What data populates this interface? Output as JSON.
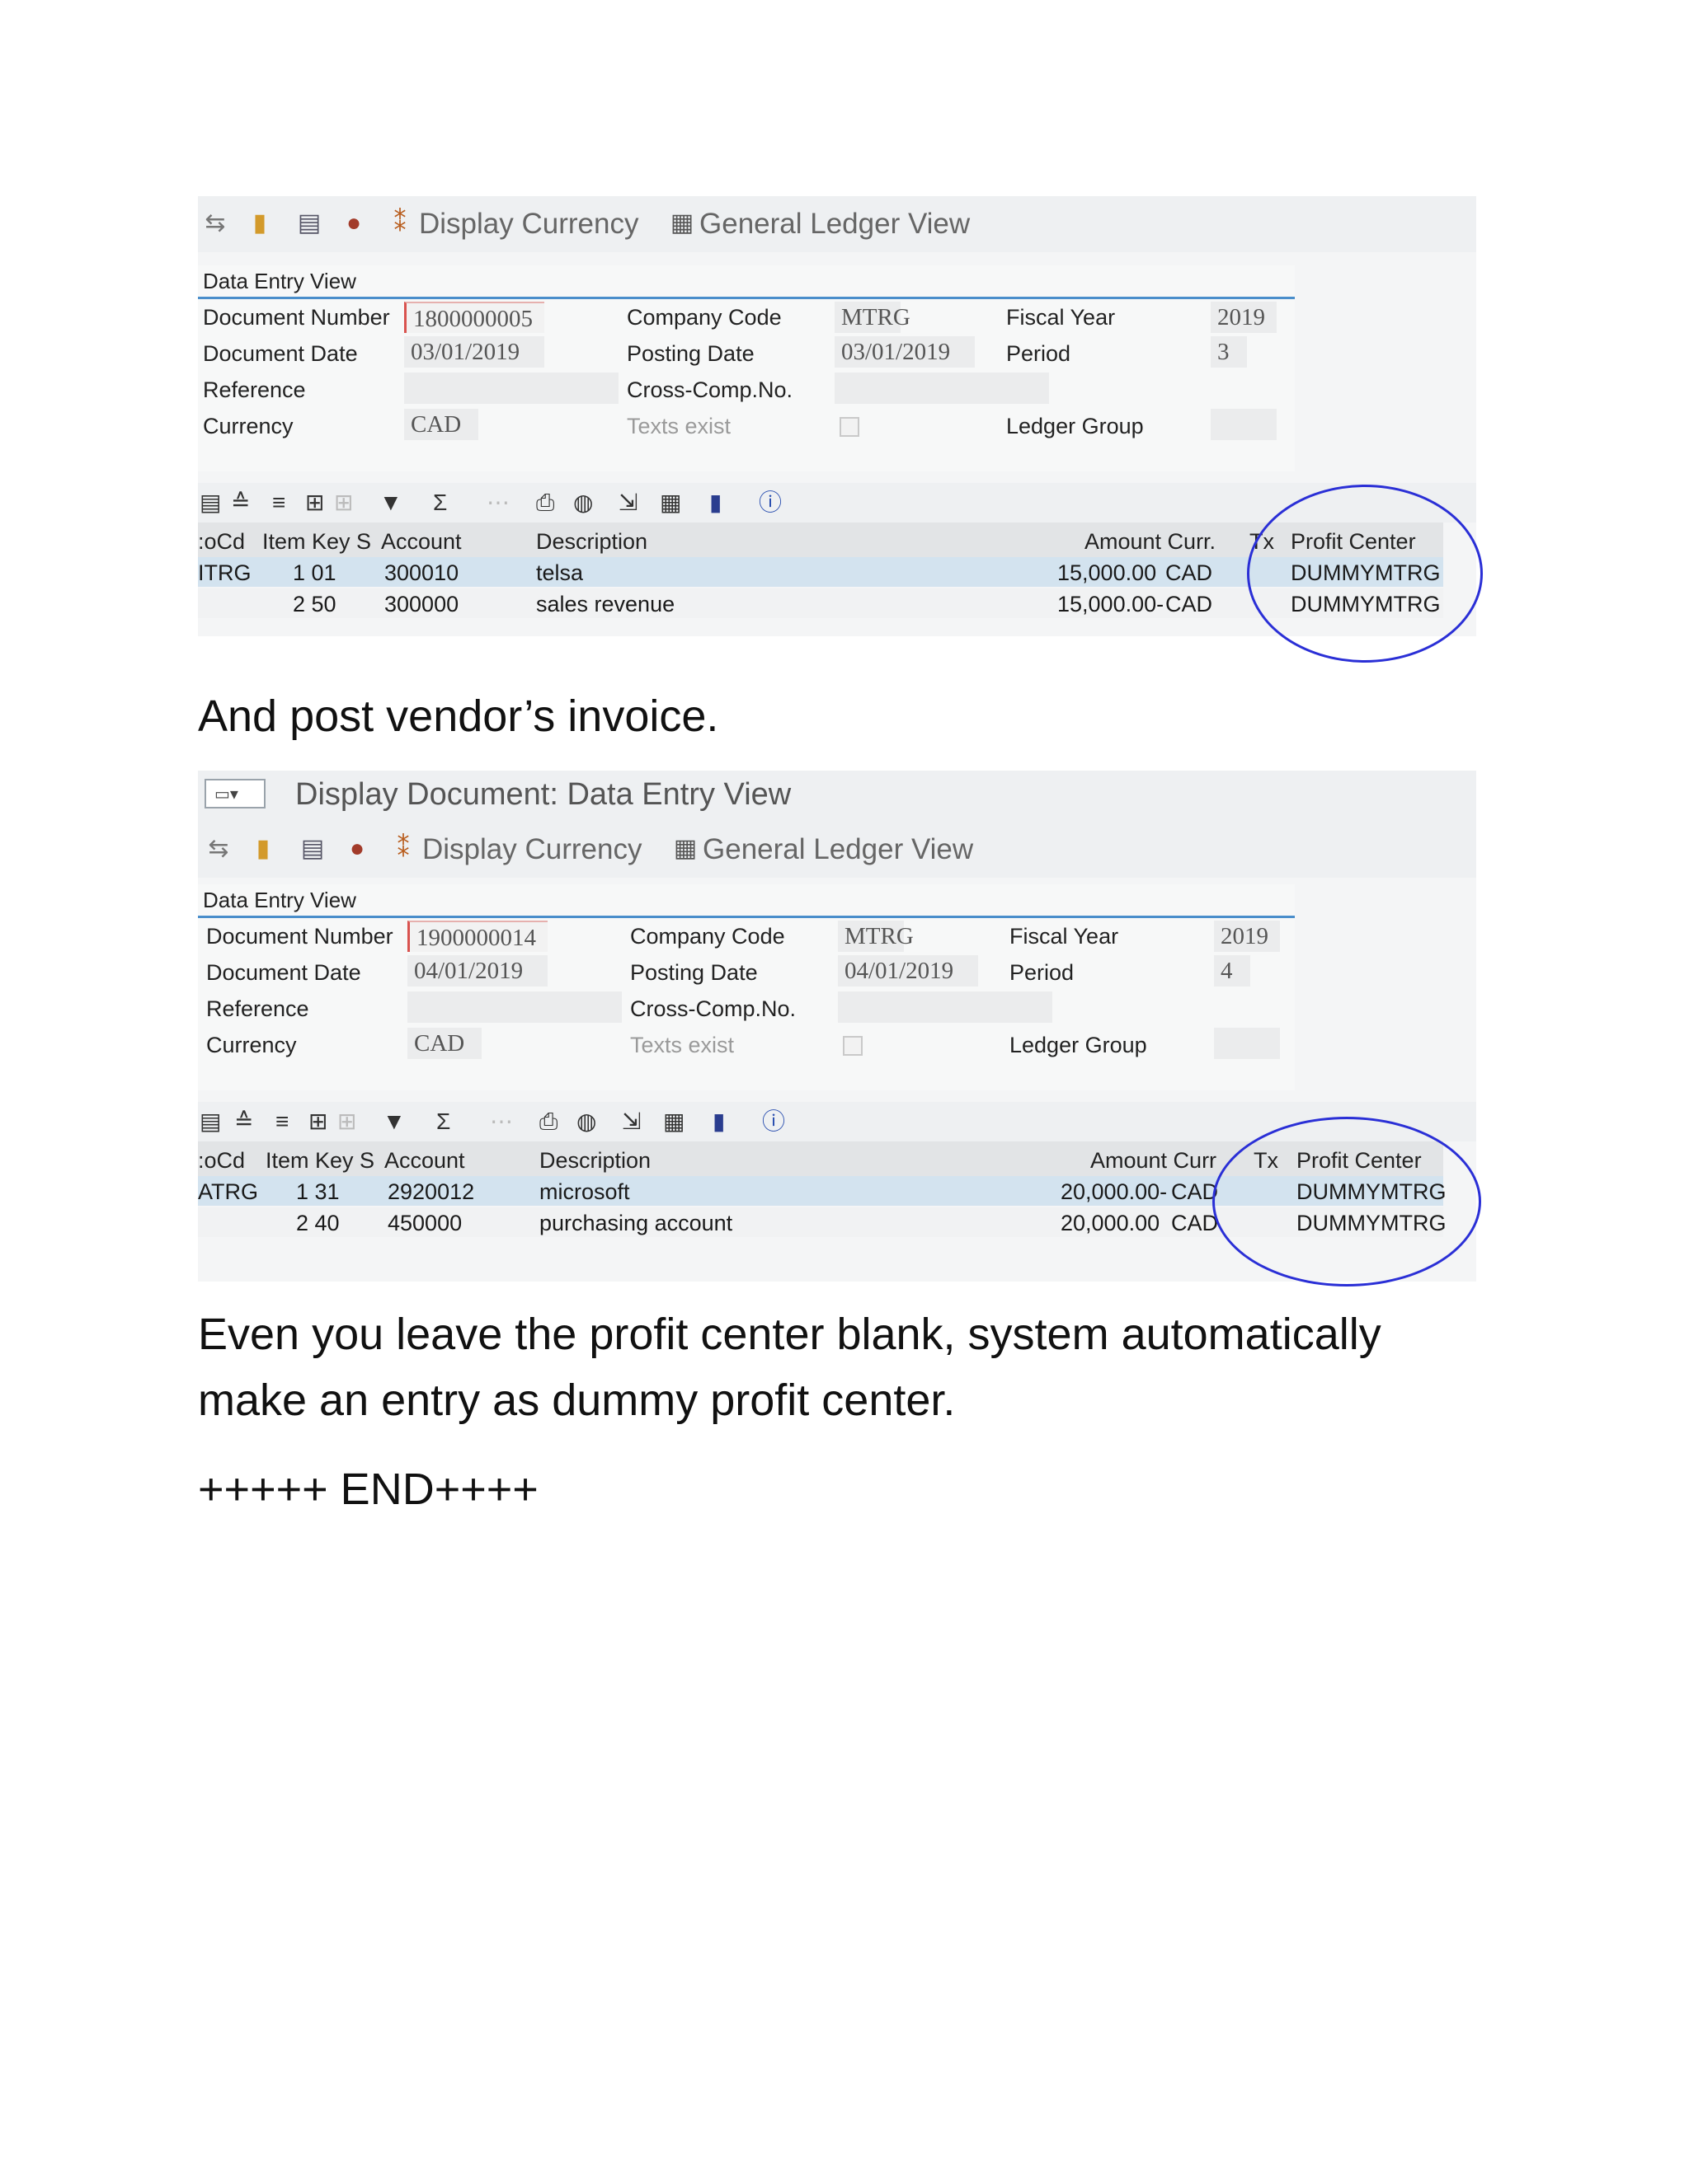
{
  "doc1": {
    "toolbar": {
      "display_currency": "Display Currency",
      "gl_view": "General Ledger View"
    },
    "panel_title": "Data Entry View",
    "fields": {
      "document_number_label": "Document Number",
      "document_number": "1800000005",
      "document_date_label": "Document Date",
      "document_date": "03/01/2019",
      "reference_label": "Reference",
      "reference": "",
      "currency_label": "Currency",
      "currency": "CAD",
      "company_code_label": "Company Code",
      "company_code": "MTRG",
      "posting_date_label": "Posting Date",
      "posting_date": "03/01/2019",
      "cross_comp_label": "Cross-Comp.No.",
      "cross_comp": "",
      "texts_exist_label": "Texts exist",
      "fiscal_year_label": "Fiscal Year",
      "fiscal_year": "2019",
      "period_label": "Period",
      "period": "3",
      "ledger_group_label": "Ledger Group",
      "ledger_group": ""
    },
    "table": {
      "headers": {
        "cocd": ":oCd",
        "item": "Item Key S",
        "account": "Account",
        "description": "Description",
        "amount": "Amount Curr.",
        "tx": "Tx",
        "profit_center": "Profit Center"
      },
      "rows": [
        {
          "cocd": "ITRG",
          "item": "1 01",
          "account": "300010",
          "description": "telsa",
          "amount": "15,000.00",
          "curr": "CAD",
          "profit_center": "DUMMYMTRG"
        },
        {
          "cocd": "",
          "item": "2 50",
          "account": "300000",
          "description": "sales revenue",
          "amount": "15,000.00-",
          "curr": "CAD",
          "profit_center": "DUMMYMTRG"
        }
      ]
    }
  },
  "intro_text": "And post vendor’s invoice.",
  "doc2": {
    "window_title": "Display Document: Data Entry View",
    "toolbar": {
      "display_currency": "Display Currency",
      "gl_view": "General Ledger View"
    },
    "panel_title": "Data Entry View",
    "fields": {
      "document_number_label": "Document Number",
      "document_number": "1900000014",
      "document_date_label": "Document Date",
      "document_date": "04/01/2019",
      "reference_label": "Reference",
      "reference": "",
      "currency_label": "Currency",
      "currency": "CAD",
      "company_code_label": "Company Code",
      "company_code": "MTRG",
      "posting_date_label": "Posting Date",
      "posting_date": "04/01/2019",
      "cross_comp_label": "Cross-Comp.No.",
      "cross_comp": "",
      "texts_exist_label": "Texts exist",
      "fiscal_year_label": "Fiscal Year",
      "fiscal_year": "2019",
      "period_label": "Period",
      "period": "4",
      "ledger_group_label": "Ledger Group",
      "ledger_group": ""
    },
    "table": {
      "headers": {
        "cocd": ":oCd",
        "item": "Item Key S",
        "account": "Account",
        "description": "Description",
        "amount": "Amount Curr",
        "tx": "Tx",
        "profit_center": "Profit Center"
      },
      "rows": [
        {
          "cocd": "ATRG",
          "item": "1 31",
          "account": "2920012",
          "description": "microsoft",
          "amount": "20,000.00-",
          "curr": "CAD",
          "profit_center": "DUMMYMTRG"
        },
        {
          "cocd": "",
          "item": "2 40",
          "account": "450000",
          "description": "purchasing account",
          "amount": "20,000.00",
          "curr": "CAD",
          "profit_center": "DUMMYMTRG"
        }
      ]
    }
  },
  "conclusion_line1": "Even you leave the profit center blank, system automatically",
  "conclusion_line2": "make an entry as dummy profit center.",
  "end_marker": "+++++ END++++",
  "colors": {
    "annotation_circle": "#2a2fd6",
    "panel_accent": "#4a8ecb",
    "selected_row": "#d3e3ef"
  }
}
